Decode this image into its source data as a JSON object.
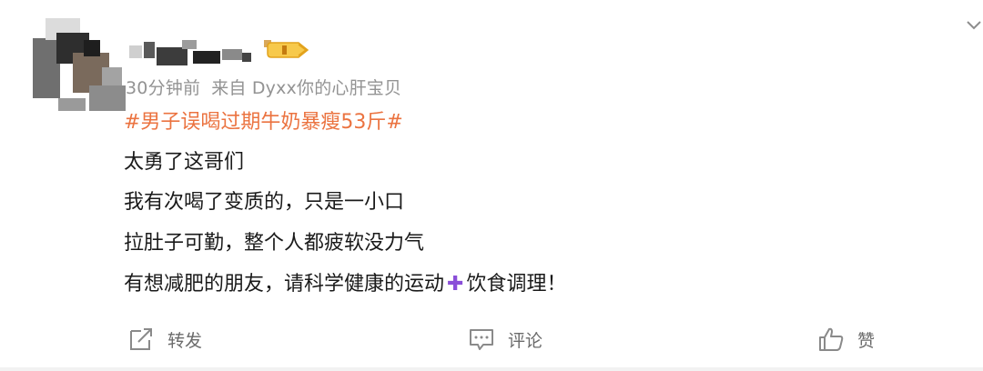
{
  "post": {
    "meta_time": "30分钟前",
    "meta_source": "来自 Dyxx你的心肝宝贝",
    "topic": "#男子误喝过期牛奶暴瘦53斤#",
    "lines": [
      "太勇了这哥们",
      "我有次喝了变质的，只是一小口",
      "拉肚子可勤，整个人都疲软没力气",
      "有想减肥的朋友，请科学健康的运动"
    ],
    "line4_tail": "饮食调理！"
  },
  "actions": {
    "repost_label": "转发",
    "comment_label": "评论",
    "like_label": "赞"
  },
  "icons": {
    "avatar": "avatar",
    "vip": "vip-badge-icon",
    "more": "chevron-down-icon",
    "repost": "share-icon",
    "comment": "comment-icon",
    "like": "thumbs-up-icon",
    "plus": "plus-icon"
  },
  "colors": {
    "topic": "#eb7340",
    "meta": "#939393",
    "action_text": "#6b6b6b",
    "plus": "#8a4fd8",
    "vip": "#f2b63a"
  }
}
